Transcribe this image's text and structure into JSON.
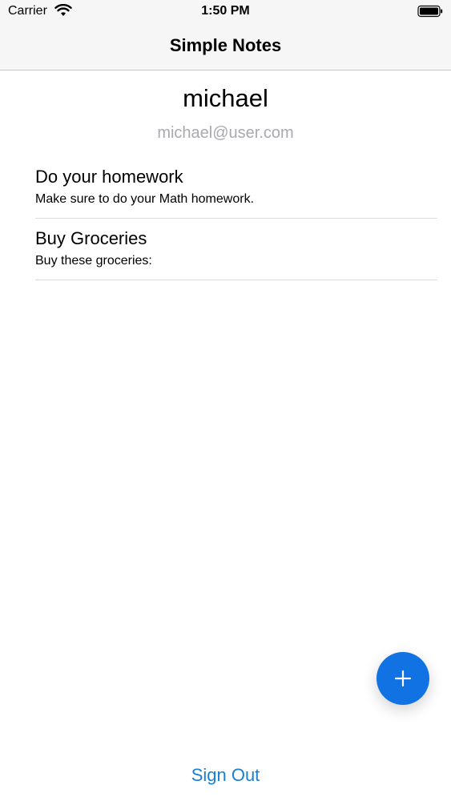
{
  "status_bar": {
    "carrier": "Carrier",
    "time": "1:50 PM",
    "icons": [
      "wifi-icon",
      "battery-icon"
    ]
  },
  "nav": {
    "title": "Simple Notes"
  },
  "profile": {
    "username": "michael",
    "email": "michael@user.com"
  },
  "notes": [
    {
      "title": "Do your homework",
      "body": "Make sure to do your Math homework."
    },
    {
      "title": "Buy Groceries",
      "body": "Buy these groceries:"
    }
  ],
  "fab": {
    "icon": "plus-icon",
    "color": "#1172e3"
  },
  "sign_out": {
    "label": "Sign Out",
    "color": "#1a7fd6"
  }
}
